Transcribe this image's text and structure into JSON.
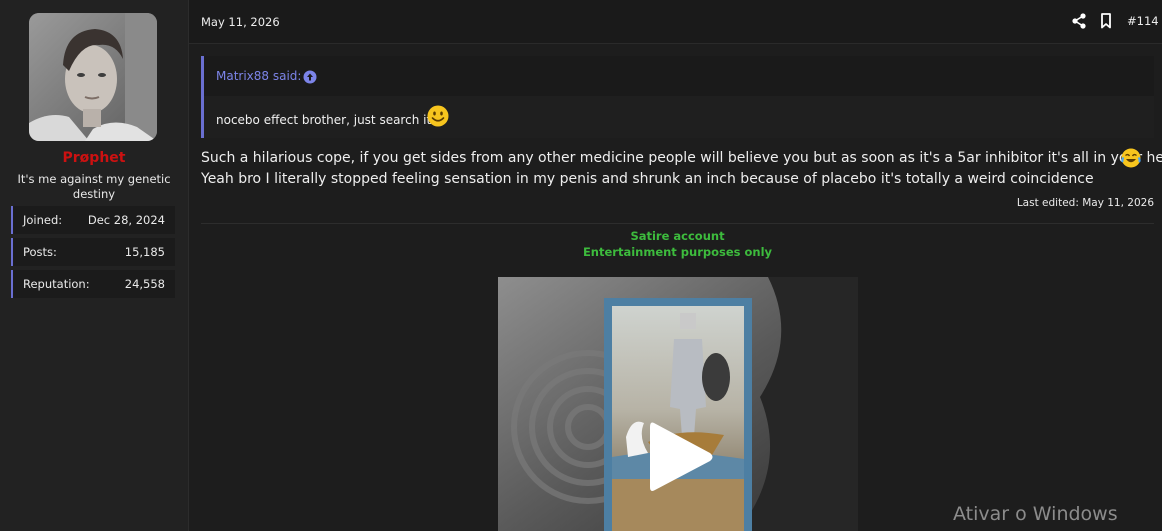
{
  "user": {
    "name": "Prøphet",
    "title": "It's me against my genetic destiny",
    "stats": [
      {
        "label": "Joined:",
        "value": "Dec 28, 2024"
      },
      {
        "label": "Posts:",
        "value": "15,185"
      },
      {
        "label": "Reputation:",
        "value": "24,558"
      }
    ]
  },
  "post": {
    "date": "May 11, 2026",
    "number": "#114",
    "icons": [
      "share-icon",
      "bookmark-icon"
    ],
    "quote": {
      "author": "Matrix88 said:",
      "text": "nocebo effect brother, just search it"
    },
    "message": {
      "line1": "Such a hilarious cope, if you get sides from any other medicine people will believe you but as soon as it's a 5ar inhibitor it's all in your head",
      "line2": "Yeah bro I literally stopped feeling sensation in my penis and shrunk an inch because of placebo it's totally a weird coincidence"
    },
    "last_edited": "Last edited: May 11, 2026",
    "signature": {
      "line1": "Satire account",
      "line2": "Entertainment purposes only"
    }
  },
  "system": {
    "watermark": "Ativar o Windows"
  },
  "colors": {
    "username": "#cc1111",
    "accent": "#6a6fd1",
    "signature": "#3dbb3d"
  }
}
